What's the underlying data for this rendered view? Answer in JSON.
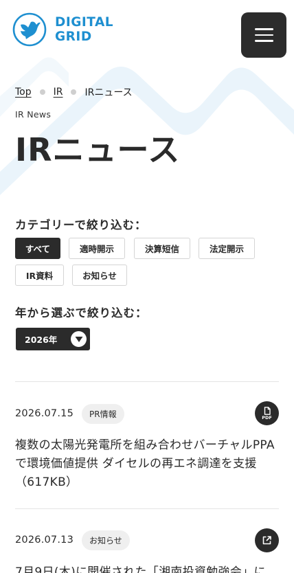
{
  "header": {
    "logo_line1": "DIGITAL",
    "logo_line2": "GRID",
    "menu_icon": "hamburger-icon"
  },
  "breadcrumb": {
    "top": "Top",
    "ir": "IR",
    "current": "IRニュース"
  },
  "page": {
    "eyebrow": "IR News",
    "title": "IRニュース"
  },
  "filters": {
    "category_label": "カテゴリーで絞り込む：",
    "categories": [
      "すべて",
      "適時開示",
      "決算短信",
      "法定開示",
      "IR資料",
      "お知らせ"
    ],
    "active_category": "すべて",
    "year_label": "年から選ぶで絞り込む：",
    "year_value": "2026年"
  },
  "news": [
    {
      "date": "2026.07.15",
      "tag": "PR情報",
      "icon": "pdf-icon",
      "icon_label": "PDF",
      "title": "複数の太陽光発電所を組み合わせバーチャルPPAで環境価値提供 ダイセルの再エネ調達を支援 （617KB）"
    },
    {
      "date": "2026.07.13",
      "tag": "お知らせ",
      "icon": "external-link-icon",
      "title": "7月9日(木)に開催された「湘南投資勉強会」に"
    }
  ],
  "colors": {
    "brand_blue": "#1e8fd0",
    "dark": "#2b2b2b",
    "swoosh": "#eaf4fb"
  }
}
